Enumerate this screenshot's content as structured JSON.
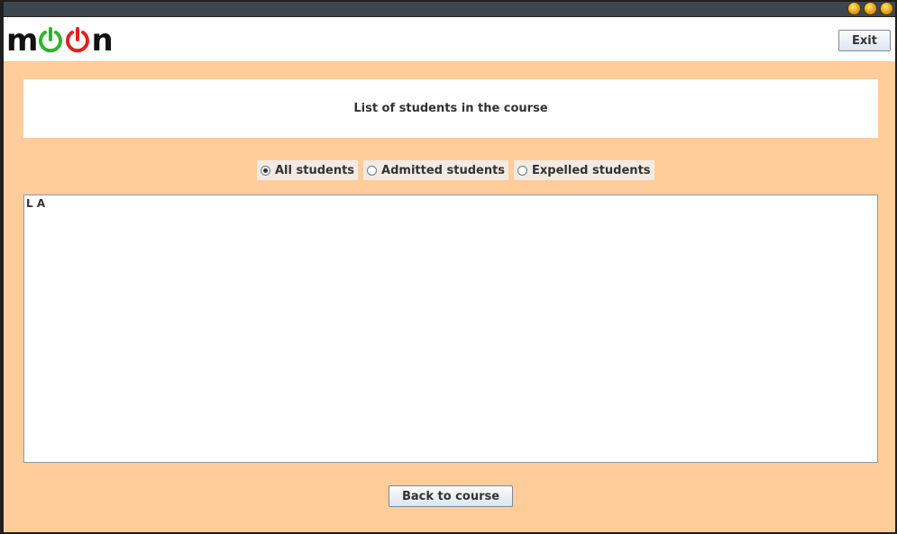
{
  "window": {
    "controls": [
      "minimize-icon",
      "maximize-icon",
      "close-icon"
    ]
  },
  "header": {
    "logo_text_left": "m",
    "logo_text_right": "n",
    "logo_icon_colors": [
      "#2bb52b",
      "#e02020"
    ],
    "exit_label": "Exit"
  },
  "main": {
    "title": "List of students in the course",
    "filters": [
      {
        "label": "All students",
        "selected": true
      },
      {
        "label": "Admitted students",
        "selected": false
      },
      {
        "label": "Expelled students",
        "selected": false
      }
    ],
    "students": [
      "L A"
    ],
    "back_label": "Back to course"
  },
  "colors": {
    "background": "#ffcc9a",
    "panel": "#ffffff",
    "titlebar": "#3e464d"
  }
}
